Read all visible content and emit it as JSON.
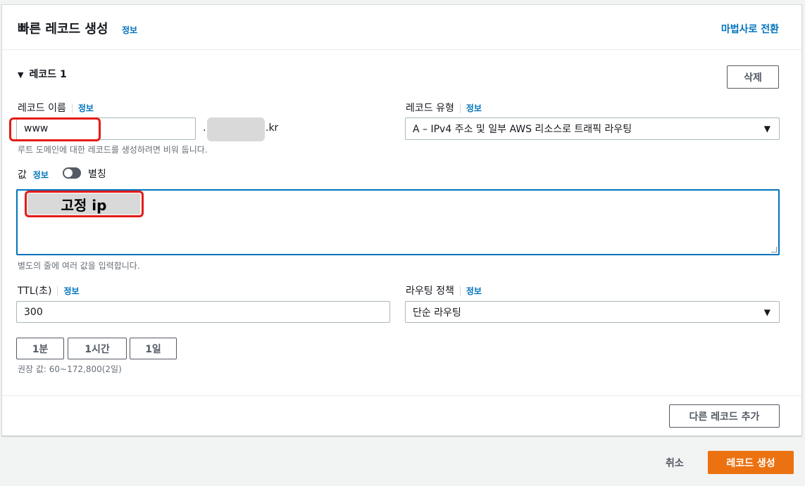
{
  "header": {
    "title": "빠른 레코드 생성",
    "info": "정보",
    "switch_to_wizard": "마법사로 전환"
  },
  "record": {
    "section_label": "레코드 1",
    "delete_label": "삭제",
    "name": {
      "label": "레코드 이름",
      "info": "정보",
      "value": "www",
      "domain_prefix": ".",
      "domain_suffix": ".kr",
      "hint": "루트 도메인에 대한 레코드를 생성하려면 비워 둡니다."
    },
    "type": {
      "label": "레코드 유형",
      "info": "정보",
      "selected": "A – IPv4 주소 및 일부 AWS 리소스로 트래픽 라우팅"
    },
    "value": {
      "label": "값",
      "info": "정보",
      "alias_label": "별칭",
      "alias_enabled": false,
      "annotation": "고정 ip",
      "hint": "별도의 줄에 여러 값을 입력합니다."
    },
    "ttl": {
      "label": "TTL(초)",
      "info": "정보",
      "value": "300",
      "presets": [
        "1분",
        "1시간",
        "1일"
      ],
      "hint": "권장 값: 60~172,800(2일)"
    },
    "routing": {
      "label": "라우팅 정책",
      "info": "정보",
      "selected": "단순 라우팅"
    },
    "add_record_label": "다른 레코드 추가"
  },
  "footer": {
    "cancel_label": "취소",
    "create_label": "레코드 생성"
  },
  "colors": {
    "link": "#0073bb",
    "primary": "#ec7211",
    "highlight": "#e41b17"
  }
}
